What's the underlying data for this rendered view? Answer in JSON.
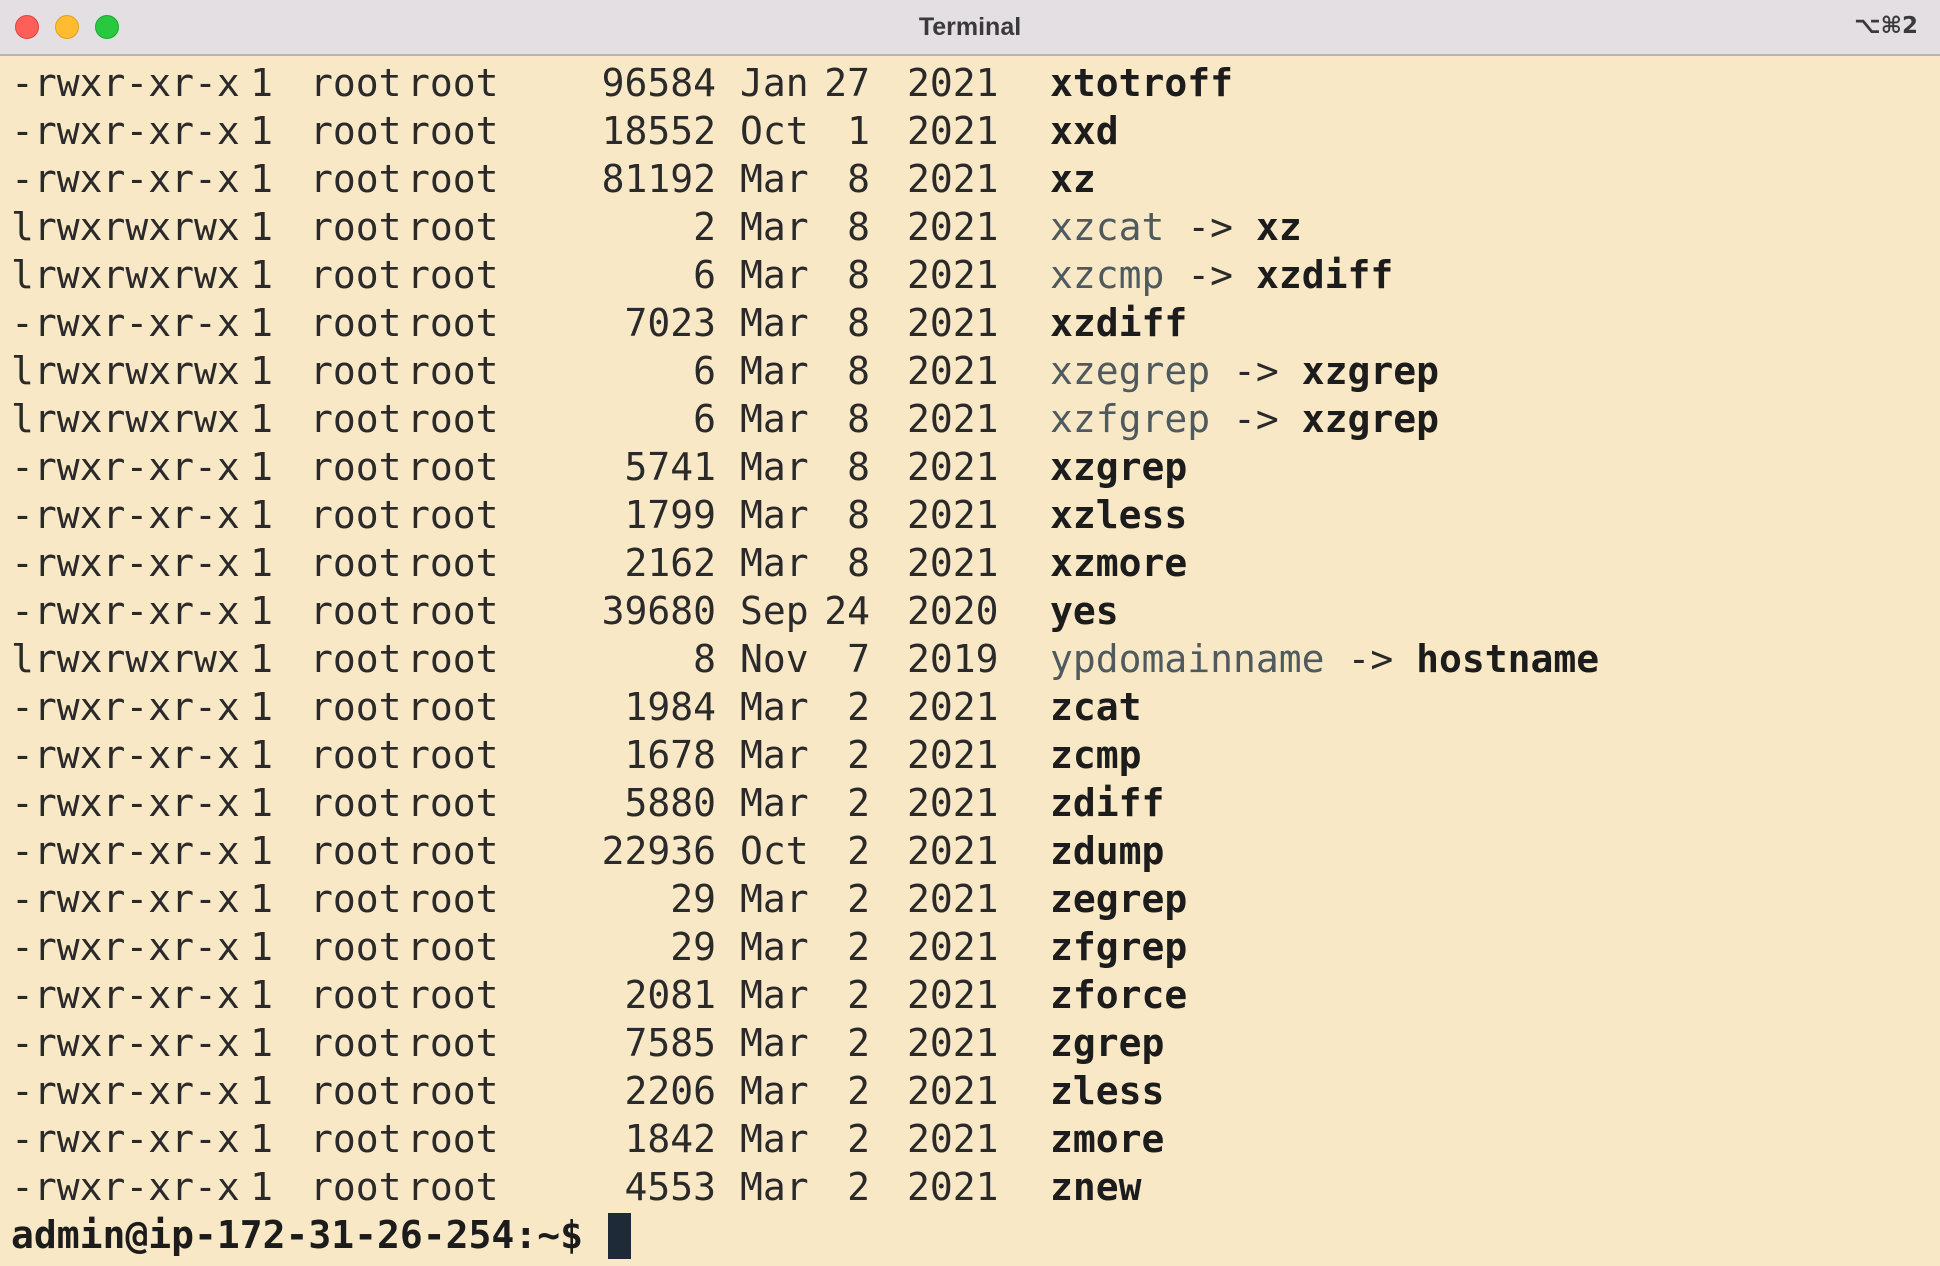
{
  "window": {
    "title": "Terminal",
    "shortcut": "⌥⌘2"
  },
  "colors": {
    "background": "#f8e8c6",
    "titlebar": "#e4dfe2",
    "symlink_name": "#4f5a5e",
    "text": "#2a2a2a",
    "cursor": "#1f2a38"
  },
  "listing": [
    {
      "perms": "-rwxr-xr-x",
      "links": "1",
      "owner": "root",
      "group": "root",
      "size": "96584",
      "month": "Jan",
      "day": "27",
      "year": "2021",
      "name": "xtotroff",
      "target": ""
    },
    {
      "perms": "-rwxr-xr-x",
      "links": "1",
      "owner": "root",
      "group": "root",
      "size": "18552",
      "month": "Oct",
      "day": "1",
      "year": "2021",
      "name": "xxd",
      "target": ""
    },
    {
      "perms": "-rwxr-xr-x",
      "links": "1",
      "owner": "root",
      "group": "root",
      "size": "81192",
      "month": "Mar",
      "day": "8",
      "year": "2021",
      "name": "xz",
      "target": ""
    },
    {
      "perms": "lrwxrwxrwx",
      "links": "1",
      "owner": "root",
      "group": "root",
      "size": "2",
      "month": "Mar",
      "day": "8",
      "year": "2021",
      "name": "xzcat",
      "target": "xz"
    },
    {
      "perms": "lrwxrwxrwx",
      "links": "1",
      "owner": "root",
      "group": "root",
      "size": "6",
      "month": "Mar",
      "day": "8",
      "year": "2021",
      "name": "xzcmp",
      "target": "xzdiff"
    },
    {
      "perms": "-rwxr-xr-x",
      "links": "1",
      "owner": "root",
      "group": "root",
      "size": "7023",
      "month": "Mar",
      "day": "8",
      "year": "2021",
      "name": "xzdiff",
      "target": ""
    },
    {
      "perms": "lrwxrwxrwx",
      "links": "1",
      "owner": "root",
      "group": "root",
      "size": "6",
      "month": "Mar",
      "day": "8",
      "year": "2021",
      "name": "xzegrep",
      "target": "xzgrep"
    },
    {
      "perms": "lrwxrwxrwx",
      "links": "1",
      "owner": "root",
      "group": "root",
      "size": "6",
      "month": "Mar",
      "day": "8",
      "year": "2021",
      "name": "xzfgrep",
      "target": "xzgrep"
    },
    {
      "perms": "-rwxr-xr-x",
      "links": "1",
      "owner": "root",
      "group": "root",
      "size": "5741",
      "month": "Mar",
      "day": "8",
      "year": "2021",
      "name": "xzgrep",
      "target": ""
    },
    {
      "perms": "-rwxr-xr-x",
      "links": "1",
      "owner": "root",
      "group": "root",
      "size": "1799",
      "month": "Mar",
      "day": "8",
      "year": "2021",
      "name": "xzless",
      "target": ""
    },
    {
      "perms": "-rwxr-xr-x",
      "links": "1",
      "owner": "root",
      "group": "root",
      "size": "2162",
      "month": "Mar",
      "day": "8",
      "year": "2021",
      "name": "xzmore",
      "target": ""
    },
    {
      "perms": "-rwxr-xr-x",
      "links": "1",
      "owner": "root",
      "group": "root",
      "size": "39680",
      "month": "Sep",
      "day": "24",
      "year": "2020",
      "name": "yes",
      "target": ""
    },
    {
      "perms": "lrwxrwxrwx",
      "links": "1",
      "owner": "root",
      "group": "root",
      "size": "8",
      "month": "Nov",
      "day": "7",
      "year": "2019",
      "name": "ypdomainname",
      "target": "hostname"
    },
    {
      "perms": "-rwxr-xr-x",
      "links": "1",
      "owner": "root",
      "group": "root",
      "size": "1984",
      "month": "Mar",
      "day": "2",
      "year": "2021",
      "name": "zcat",
      "target": ""
    },
    {
      "perms": "-rwxr-xr-x",
      "links": "1",
      "owner": "root",
      "group": "root",
      "size": "1678",
      "month": "Mar",
      "day": "2",
      "year": "2021",
      "name": "zcmp",
      "target": ""
    },
    {
      "perms": "-rwxr-xr-x",
      "links": "1",
      "owner": "root",
      "group": "root",
      "size": "5880",
      "month": "Mar",
      "day": "2",
      "year": "2021",
      "name": "zdiff",
      "target": ""
    },
    {
      "perms": "-rwxr-xr-x",
      "links": "1",
      "owner": "root",
      "group": "root",
      "size": "22936",
      "month": "Oct",
      "day": "2",
      "year": "2021",
      "name": "zdump",
      "target": ""
    },
    {
      "perms": "-rwxr-xr-x",
      "links": "1",
      "owner": "root",
      "group": "root",
      "size": "29",
      "month": "Mar",
      "day": "2",
      "year": "2021",
      "name": "zegrep",
      "target": ""
    },
    {
      "perms": "-rwxr-xr-x",
      "links": "1",
      "owner": "root",
      "group": "root",
      "size": "29",
      "month": "Mar",
      "day": "2",
      "year": "2021",
      "name": "zfgrep",
      "target": ""
    },
    {
      "perms": "-rwxr-xr-x",
      "links": "1",
      "owner": "root",
      "group": "root",
      "size": "2081",
      "month": "Mar",
      "day": "2",
      "year": "2021",
      "name": "zforce",
      "target": ""
    },
    {
      "perms": "-rwxr-xr-x",
      "links": "1",
      "owner": "root",
      "group": "root",
      "size": "7585",
      "month": "Mar",
      "day": "2",
      "year": "2021",
      "name": "zgrep",
      "target": ""
    },
    {
      "perms": "-rwxr-xr-x",
      "links": "1",
      "owner": "root",
      "group": "root",
      "size": "2206",
      "month": "Mar",
      "day": "2",
      "year": "2021",
      "name": "zless",
      "target": ""
    },
    {
      "perms": "-rwxr-xr-x",
      "links": "1",
      "owner": "root",
      "group": "root",
      "size": "1842",
      "month": "Mar",
      "day": "2",
      "year": "2021",
      "name": "zmore",
      "target": ""
    },
    {
      "perms": "-rwxr-xr-x",
      "links": "1",
      "owner": "root",
      "group": "root",
      "size": "4553",
      "month": "Mar",
      "day": "2",
      "year": "2021",
      "name": "znew",
      "target": ""
    }
  ],
  "symlink_arrow": "->",
  "prompt": "admin@ip-172-31-26-254:~$ "
}
